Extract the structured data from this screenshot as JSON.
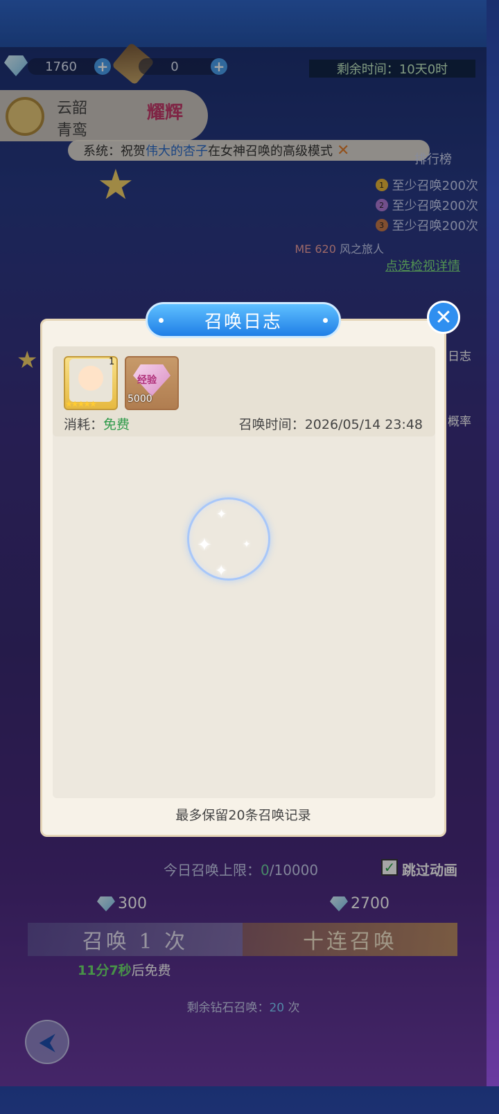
{
  "top": {
    "diamonds": "1760",
    "scrolls": "0",
    "timer_label": "剩余时间：",
    "timer_value": "10天0时"
  },
  "hero_card": {
    "line1": "云韶",
    "line2": "青鸾",
    "badge": "耀辉"
  },
  "ticker": {
    "prefix": "系统：祝贺",
    "player": "伟大的杏子",
    "suffix": "在女神召唤的高级模式"
  },
  "ranking": {
    "title": "排行榜",
    "items": [
      {
        "rank": "1",
        "text": "至少召唤200次"
      },
      {
        "rank": "2",
        "text": "至少召唤200次"
      },
      {
        "rank": "3",
        "text": "至少召唤200次"
      }
    ],
    "me_label": "ME 620",
    "me_name": "风之旅人",
    "view_detail": "点选检视详情"
  },
  "modal": {
    "title": "召唤日志",
    "entry": {
      "hero_count": "1",
      "hero_stars": "★★★★★",
      "gem_label": "经验",
      "gem_count": "5000",
      "cost_label": "消耗：",
      "cost_value": "免费",
      "time_label": "召唤时间：",
      "time_value": "2026/05/14 23:48"
    },
    "footer": "最多保留20条召唤记录"
  },
  "side_labels": {
    "log": "日志",
    "rate": "概率"
  },
  "bottom": {
    "limit_label": "今日召唤上限：",
    "limit_current": "0",
    "limit_total": "/10000",
    "skip_label": "跳过动画",
    "single_cost": "300",
    "ten_cost": "2700",
    "single_label": "召唤 1 次",
    "ten_label": "十连召唤",
    "free_time": "11分7秒",
    "free_suffix": "后免费",
    "remain_label": "剩余钻石召唤：",
    "remain_value": "20",
    "remain_unit": " 次"
  },
  "colors": {
    "accent": "#1f7ee6",
    "free_green": "#2e9a4a",
    "highlight": "#2a6ac8"
  },
  "icons": [
    "plus-icon",
    "gear-icon",
    "close-icon",
    "diamond-icon",
    "check-icon",
    "back-icon",
    "sparkle-icon"
  ]
}
